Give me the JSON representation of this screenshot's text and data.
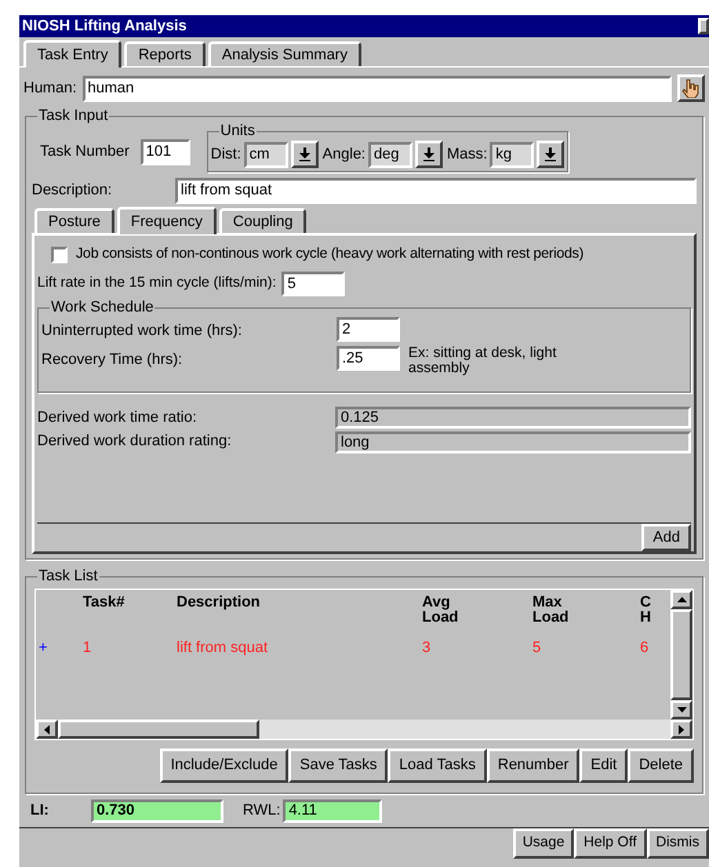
{
  "window": {
    "title": "NIOSH Lifting Analysis"
  },
  "tabs": [
    {
      "label": "Task Entry",
      "selected": true
    },
    {
      "label": "Reports",
      "selected": false
    },
    {
      "label": "Analysis Summary",
      "selected": false
    }
  ],
  "human": {
    "label": "Human:",
    "value": "human"
  },
  "task_input": {
    "title": "Task Input",
    "task_number": {
      "label": "Task Number",
      "value": "101"
    },
    "units": {
      "title": "Units",
      "fields": [
        {
          "label": "Dist:",
          "value": "cm"
        },
        {
          "label": "Angle:",
          "value": "deg"
        },
        {
          "label": "Mass:",
          "value": "kg"
        }
      ]
    },
    "description": {
      "label": "Description:",
      "value": "lift from squat"
    },
    "tabs": [
      {
        "label": "Posture",
        "selected": false
      },
      {
        "label": "Frequency",
        "selected": true
      },
      {
        "label": "Coupling",
        "selected": false
      }
    ],
    "frequency": {
      "checkbox": {
        "label": "Job consists of non-continous work cycle (heavy work alternating with rest periods)",
        "checked": false
      },
      "lift_rate": {
        "label": "Lift rate in the 15 min cycle (lifts/min):",
        "value": "5"
      },
      "work_schedule": {
        "title": "Work Schedule",
        "rows": [
          {
            "label": "Uninterrupted work time (hrs):",
            "value": "2"
          },
          {
            "label": "Recovery Time (hrs):",
            "value": ".25",
            "note": "Ex: sitting at desk, light assembly"
          }
        ]
      },
      "derived": [
        {
          "label": "Derived work time ratio:",
          "value": "0.125"
        },
        {
          "label": "Derived work duration rating:",
          "value": "long"
        }
      ]
    },
    "add_button": "Add"
  },
  "task_list": {
    "title": "Task List",
    "columns": [
      "Task#",
      "Description",
      "Avg Load",
      "Max Load",
      "C H"
    ],
    "rows": [
      {
        "marker": "+",
        "cells": [
          "1",
          "lift from squat",
          "3",
          "5",
          "6"
        ]
      }
    ],
    "buttons": [
      "Include/Exclude",
      "Save Tasks",
      "Load Tasks",
      "Renumber",
      "Edit",
      "Delete"
    ]
  },
  "li": {
    "label": "LI:",
    "value": "0.730"
  },
  "rwl": {
    "label": "RWL:",
    "value": "4.11"
  },
  "footer_buttons": [
    "Usage",
    "Help Off",
    "Dismis"
  ]
}
